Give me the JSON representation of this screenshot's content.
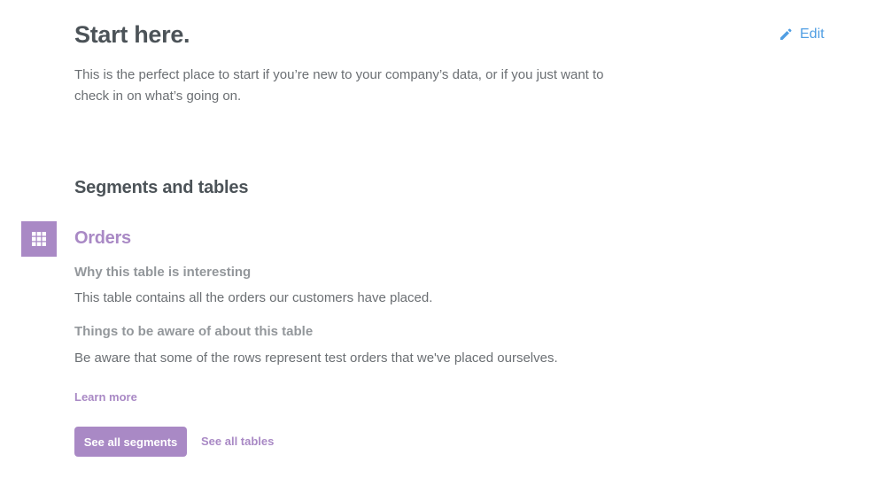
{
  "header": {
    "title": "Start here.",
    "edit_label": "Edit",
    "intro": "This is the perfect place to start if you’re new to your company’s data, or if you just want to check in on what’s going on."
  },
  "section": {
    "title": "Segments and tables"
  },
  "table": {
    "name": "Orders",
    "why_heading": "Why this table is interesting",
    "why_text": "This table contains all the orders our customers have placed.",
    "caveats_heading": "Things to be aware of about this table",
    "caveats_text": "Be aware that some of the rows represent test orders that we've placed ourselves.",
    "learn_more": "Learn more",
    "icon": "grid-table-icon"
  },
  "actions": {
    "see_segments": "See all segments",
    "see_tables": "See all tables"
  },
  "colors": {
    "accent": "#a989c5",
    "link_blue": "#509ee3",
    "heading": "#4c5358",
    "body": "#6b6f73",
    "subhead": "#93979b"
  }
}
